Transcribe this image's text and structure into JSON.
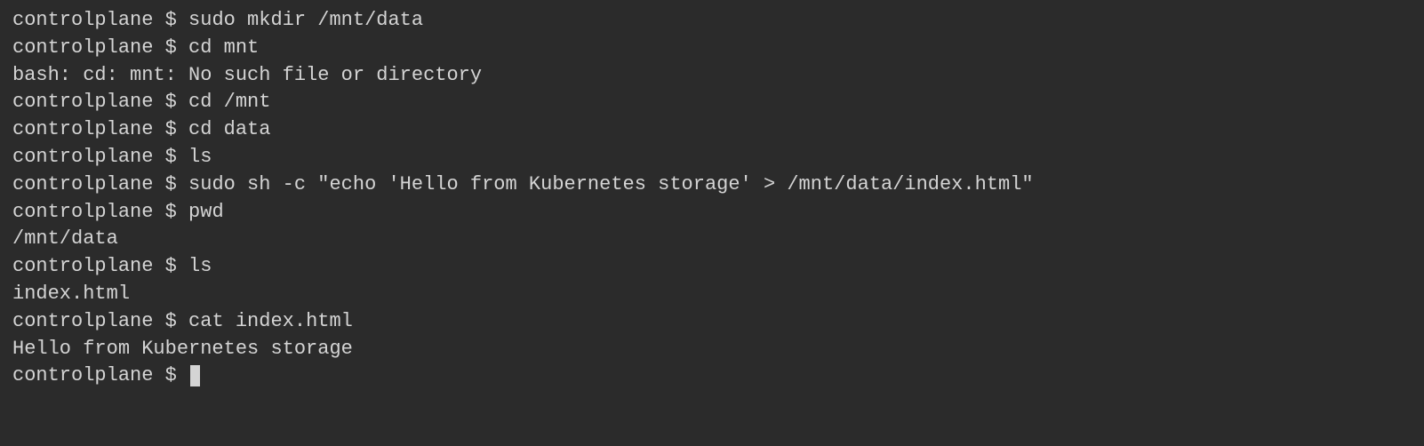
{
  "terminal": {
    "prompt": "controlplane $ ",
    "lines": [
      {
        "type": "command",
        "text": "sudo mkdir /mnt/data"
      },
      {
        "type": "command",
        "text": "cd mnt"
      },
      {
        "type": "output",
        "text": "bash: cd: mnt: No such file or directory"
      },
      {
        "type": "command",
        "text": "cd /mnt"
      },
      {
        "type": "command",
        "text": "cd data"
      },
      {
        "type": "command",
        "text": "ls"
      },
      {
        "type": "command",
        "text": "sudo sh -c \"echo 'Hello from Kubernetes storage' > /mnt/data/index.html\""
      },
      {
        "type": "command",
        "text": "pwd"
      },
      {
        "type": "output",
        "text": "/mnt/data"
      },
      {
        "type": "command",
        "text": "ls"
      },
      {
        "type": "output",
        "text": "index.html"
      },
      {
        "type": "command",
        "text": "cat index.html"
      },
      {
        "type": "output",
        "text": "Hello from Kubernetes storage"
      },
      {
        "type": "prompt",
        "text": ""
      }
    ]
  }
}
